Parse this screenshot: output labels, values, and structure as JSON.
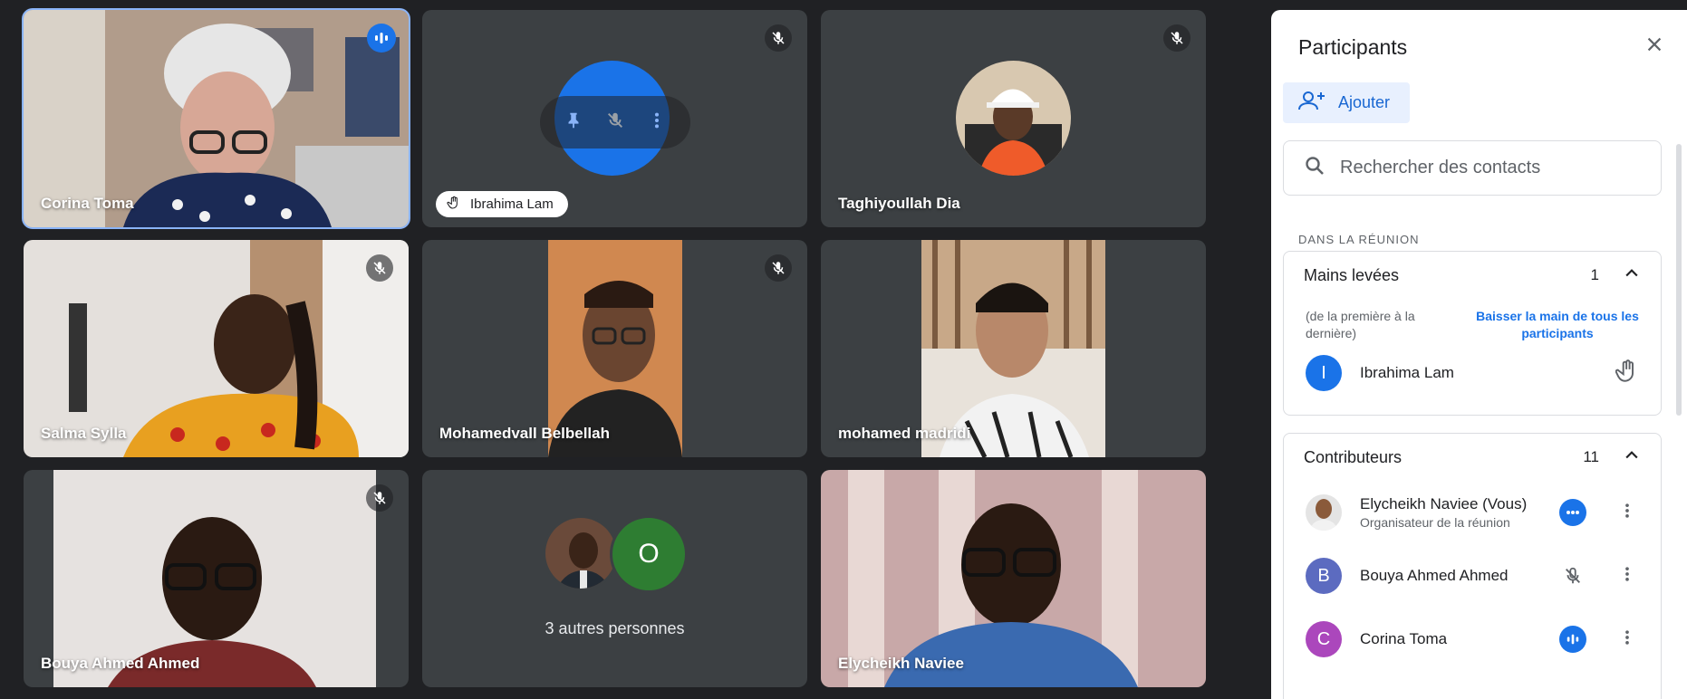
{
  "tiles": [
    {
      "name": "Corina Toma",
      "status": "speaking"
    },
    {
      "name": "Ibrahima Lam",
      "status": "muted",
      "hand_raised": true
    },
    {
      "name": "Taghiyoullah Dia",
      "status": "muted"
    },
    {
      "name": "Salma Sylla",
      "status": "muted"
    },
    {
      "name": "Mohamedvall Belbellah",
      "status": "muted"
    },
    {
      "name": "mohamed madridi",
      "status": "muted"
    },
    {
      "name": "Bouya Ahmed Ahmed",
      "status": "muted"
    },
    {
      "others_label": "3 autres personnes",
      "avatar_letter": "O"
    },
    {
      "name": "Elycheikh Naviee",
      "status": "unmuted"
    }
  ],
  "panel": {
    "title": "Participants",
    "add_label": "Ajouter",
    "search_placeholder": "Rechercher des contacts",
    "section_label": "DANS LA RÉUNION",
    "hands": {
      "title": "Mains levées",
      "count": "1",
      "note": "(de la première à la dernière)",
      "lower_all": "Baisser la main de tous les participants",
      "people": [
        {
          "name": "Ibrahima Lam",
          "initial": "I",
          "color": "#1a73e8"
        }
      ]
    },
    "contributors": {
      "title": "Contributeurs",
      "count": "11",
      "people": [
        {
          "name": "Elycheikh Naviee (Vous)",
          "role": "Organisateur de la réunion",
          "status": "more"
        },
        {
          "name": "Bouya Ahmed Ahmed",
          "initial": "B",
          "color": "#5c6bc0",
          "status": "muted"
        },
        {
          "name": "Corina Toma",
          "initial": "C",
          "color": "#ab47bc",
          "status": "speaking"
        }
      ]
    }
  },
  "colors": {
    "accent": "#1a73e8",
    "tile_bg": "#3c4043",
    "page_bg": "#202124"
  }
}
